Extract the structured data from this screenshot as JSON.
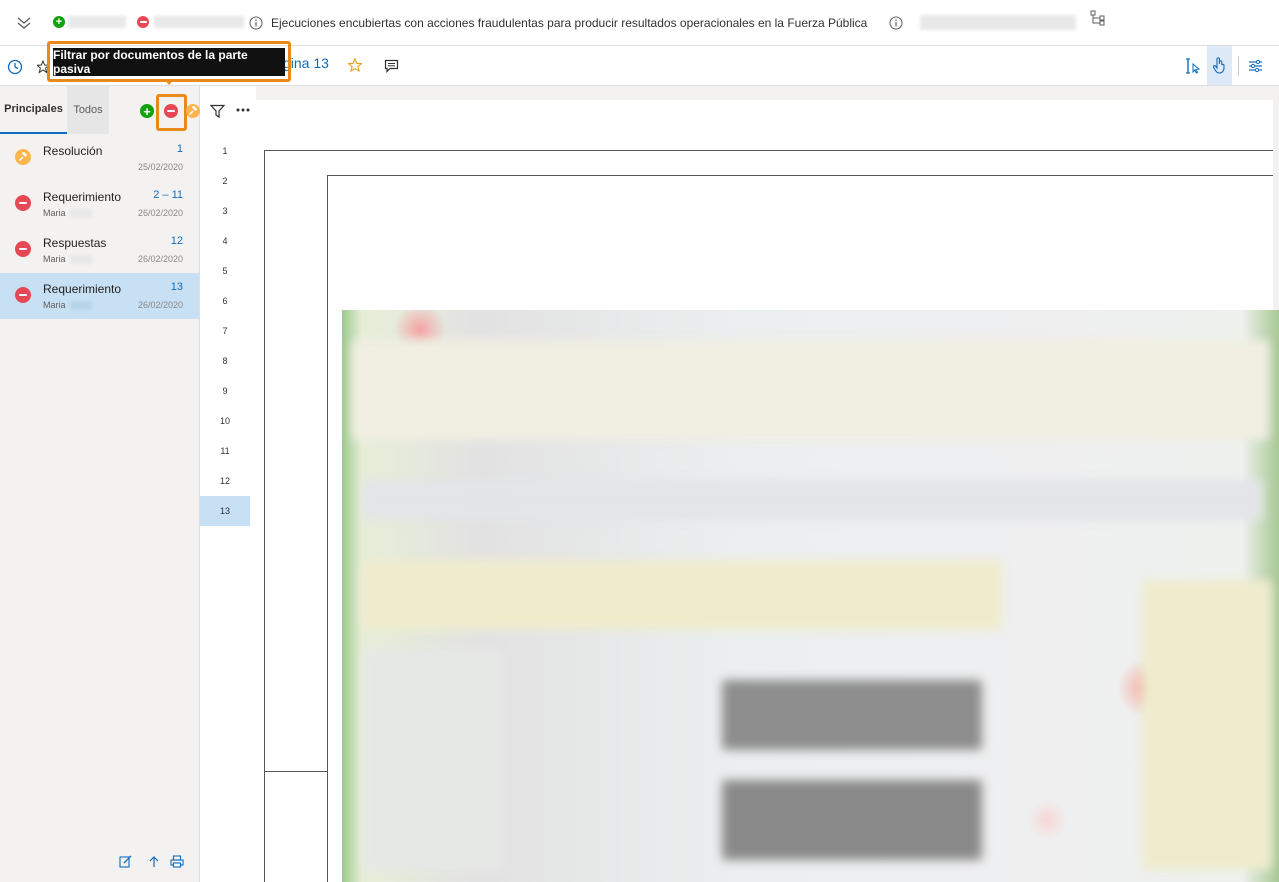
{
  "header": {
    "case_title": "Ejecuciones encubiertas con acciones fraudulentas para producir resultados operacionales en la Fuerza Pública"
  },
  "toolbar": {
    "page_label": "gina 13"
  },
  "tooltip": {
    "text": "Filtrar por documentos de la parte pasiva"
  },
  "sidebar": {
    "tabs": [
      "Principales",
      "Todos"
    ],
    "documents": [
      {
        "type": "resolucion",
        "title": "Resolución",
        "author": "",
        "pages": "1",
        "date": "25/02/2020",
        "selected": false
      },
      {
        "type": "pasiva",
        "title": "Requerimiento",
        "author": "Maria",
        "pages": "2 – 11",
        "date": "26/02/2020",
        "selected": false
      },
      {
        "type": "pasiva",
        "title": "Respuestas",
        "author": "Maria",
        "pages": "12",
        "date": "26/02/2020",
        "selected": false
      },
      {
        "type": "pasiva",
        "title": "Requerimiento",
        "author": "Maria",
        "pages": "13",
        "date": "26/02/2020",
        "selected": true
      }
    ]
  },
  "page_numbers": [
    "1",
    "2",
    "3",
    "4",
    "5",
    "6",
    "7",
    "8",
    "9",
    "10",
    "11",
    "12",
    "13"
  ],
  "selected_page": "13",
  "colors": {
    "accent": "#0f6cbd",
    "activa": "#13a10e",
    "pasiva": "#e74856",
    "resolucion": "#fcb64d",
    "highlight": "#e88a1a",
    "selection": "#c7e0f4"
  },
  "icons": [
    "chevron-down-icon",
    "plus-icon",
    "minus-icon",
    "info-icon",
    "hierarchy-icon",
    "clock-icon",
    "star-icon",
    "comment-icon",
    "select-text-icon",
    "hand-icon",
    "settings-icon",
    "gavel-icon",
    "filter-icon",
    "more-icon",
    "edit-icon",
    "upload-icon",
    "print-icon"
  ]
}
